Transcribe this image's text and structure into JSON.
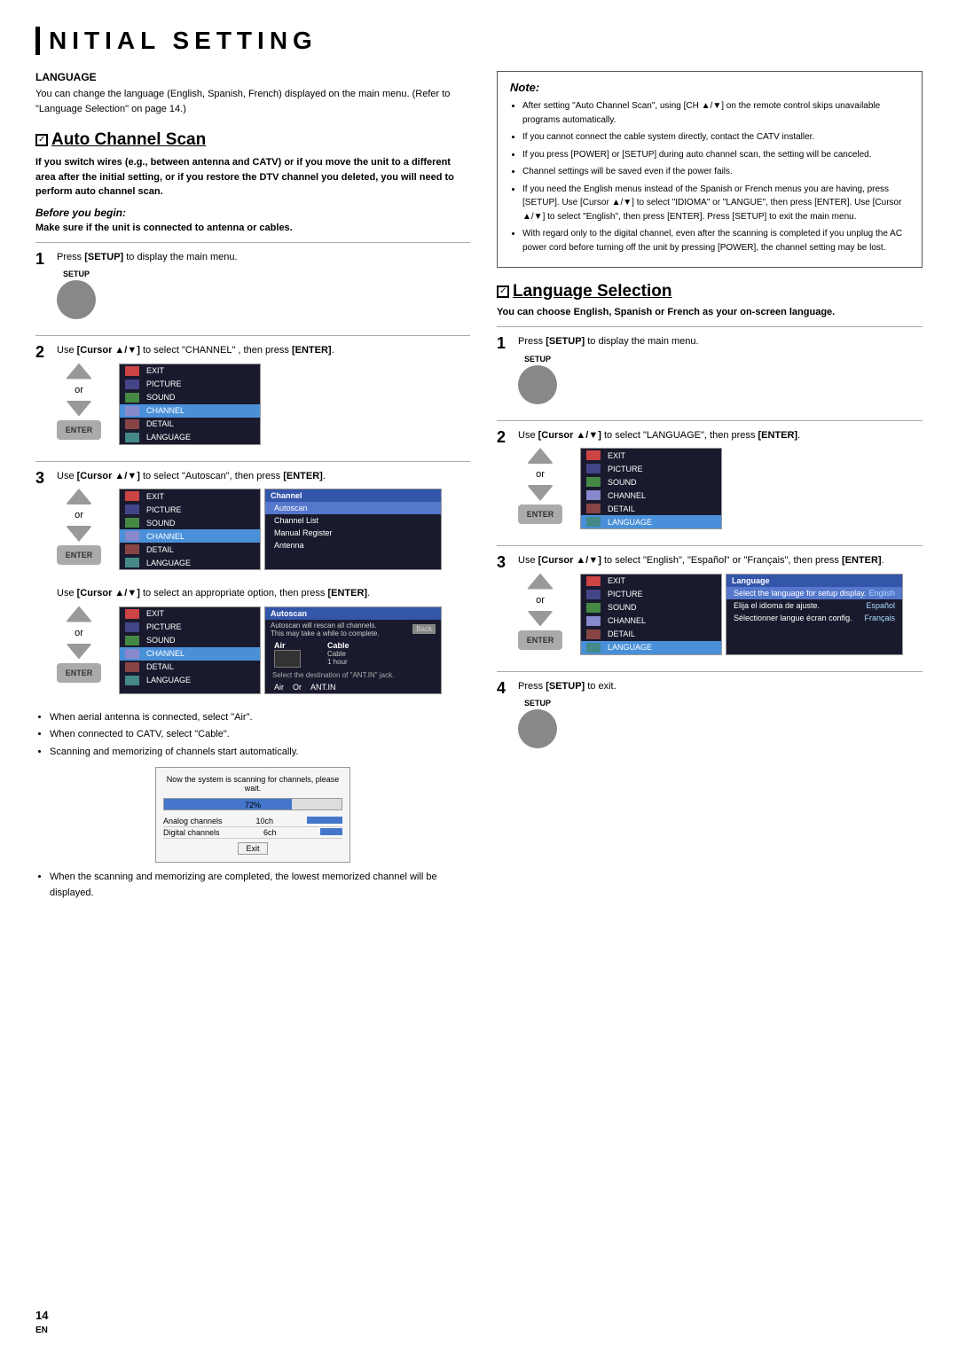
{
  "page": {
    "title": "NITIAL  SETTING",
    "page_number": "14",
    "page_num_label": "EN"
  },
  "left_col": {
    "language_section": {
      "title": "LANGUAGE",
      "text": "You can change the language (English, Spanish, French) displayed on the main menu. (Refer to \"Language Selection\" on page 14.)"
    },
    "auto_channel": {
      "heading": "Auto Channel Scan",
      "warning": "If you switch wires (e.g., between antenna and CATV) or if you move the unit to a different area after the initial setting, or if you restore the DTV channel you deleted, you will need to perform auto channel scan.",
      "before_begin": "Before you begin:",
      "before_begin_text": "Make sure if the unit is connected to antenna or cables.",
      "steps": [
        {
          "num": "1",
          "text": "Press [SETUP] to display the main menu.",
          "setup_label": "SETUP"
        },
        {
          "num": "2",
          "text": "Use [Cursor ▲/▼] to select \"CHANNEL\" , then press [ENTER].",
          "or_text": "or"
        },
        {
          "num": "3",
          "text": "Use [Cursor ▲/▼] to select \"Autoscan\", then press [ENTER].",
          "or_text": "or"
        },
        {
          "num": "4_note",
          "text": "Use [Cursor ▲/▼] to select an appropriate option, then press [ENTER].",
          "or_text": "or"
        }
      ],
      "bullets": [
        "When aerial antenna is connected, select \"Air\".",
        "When connected to CATV, select \"Cable\".",
        "Scanning and memorizing of channels start automatically."
      ],
      "scan_progress": {
        "title": "Now the system is scanning for channels, please wait.",
        "percent": "72%",
        "analog_label": "Analog channels",
        "analog_value": "10ch",
        "digital_label": "Digital channels",
        "digital_value": "6ch",
        "exit_label": "Exit"
      },
      "final_bullet": "When the scanning and memorizing are completed, the lowest memorized channel will be displayed."
    }
  },
  "right_col": {
    "note": {
      "title": "Note:",
      "items": [
        "After setting \"Auto Channel Scan\", using [CH ▲/▼] on the remote control skips unavailable programs automatically.",
        "If you cannot connect the cable system directly, contact the CATV installer.",
        "If you press [POWER] or [SETUP] during auto channel scan, the setting will be canceled.",
        "Channel settings will be saved even if the power fails.",
        "If you need the English menus instead of the Spanish or French menus you are having, press [SETUP]. Use [Cursor ▲/▼] to select \"IDIOMA\" or \"LANGUE\", then press [ENTER]. Use [Cursor ▲/▼] to select \"English\", then press [ENTER]. Press [SETUP] to exit the main menu.",
        "With regard only to the digital channel, even after the scanning is completed if you unplug the AC power cord before turning off the unit by pressing [POWER], the channel setting may be lost."
      ]
    },
    "language_selection": {
      "heading": "Language Selection",
      "subtitle": "You can choose English, Spanish or French as your on-screen language.",
      "steps": [
        {
          "num": "1",
          "text": "Press [SETUP] to display the main menu.",
          "setup_label": "SETUP"
        },
        {
          "num": "2",
          "text": "Use [Cursor ▲/▼] to select \"LANGUAGE\", then press [ENTER].",
          "or_text": "or"
        },
        {
          "num": "3",
          "text": "Use [Cursor ▲/▼] to select \"English\", \"Español\" or \"Français\", then press [ENTER].",
          "or_text": "or",
          "lang_menu": {
            "header": "Language",
            "entries": [
              {
                "label": "Select the language for setup display.",
                "value": "English"
              },
              {
                "label": "Elija el idioma de ajuste.",
                "value": "Español"
              },
              {
                "label": "Sélectionner langue écran config.",
                "value": "Français"
              }
            ]
          }
        },
        {
          "num": "4",
          "text": "Press [SETUP] to exit.",
          "setup_label": "SETUP"
        }
      ]
    }
  },
  "menus": {
    "main_menu_items": [
      {
        "label": "EXIT",
        "icon": "exit"
      },
      {
        "label": "PICTURE",
        "icon": "picture"
      },
      {
        "label": "SOUND",
        "icon": "sound"
      },
      {
        "label": "CHANNEL",
        "icon": "channel",
        "active": true
      },
      {
        "label": "DETAIL",
        "icon": "detail"
      },
      {
        "label": "LANGUAGE",
        "icon": "language"
      }
    ],
    "channel_submenu": [
      {
        "label": "Autoscan",
        "selected": true
      },
      {
        "label": "Channel List"
      },
      {
        "label": "Manual Register"
      },
      {
        "label": "Antenna"
      }
    ],
    "autoscan_options": {
      "back": "Back",
      "options": [
        "Air",
        "Cable",
        "Cable 1 hour"
      ]
    }
  }
}
